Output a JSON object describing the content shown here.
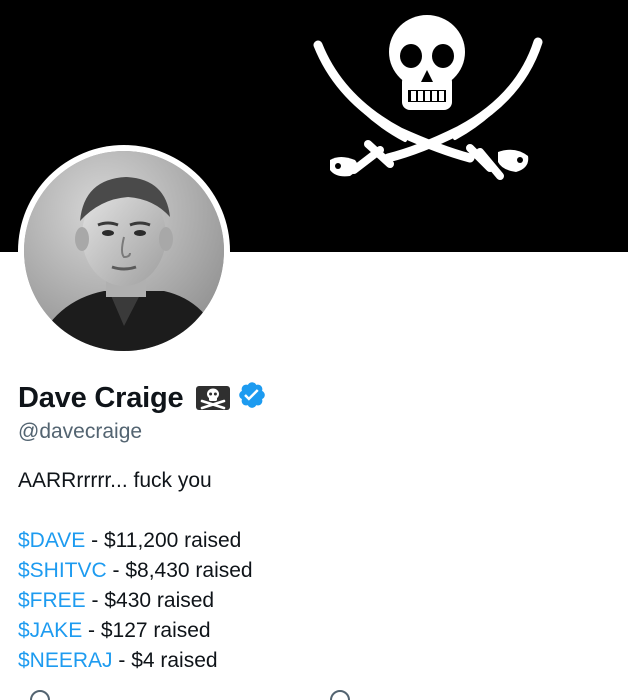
{
  "profile": {
    "display_name": "Dave Craige",
    "handle": "@davecraige",
    "bio_first_line": "AARRrrrrr... fuck you",
    "raises": [
      {
        "cashtag": "$DAVE",
        "text": " - $11,200 raised"
      },
      {
        "cashtag": "$SHITVC",
        "text": " - $8,430 raised"
      },
      {
        "cashtag": "$FREE",
        "text": " - $430 raised"
      },
      {
        "cashtag": "$JAKE",
        "text": " - $127 raised"
      },
      {
        "cashtag": "$NEERAJ",
        "text": " - $4 raised"
      }
    ]
  },
  "icons": {
    "banner": "jolly-roger-skull-crossed-swords",
    "name_emoji": "pirate-flag-icon",
    "badge": "verified-badge-icon"
  },
  "colors": {
    "accent": "#1d9bf0",
    "text": "#0f1419",
    "secondary_text": "#536471",
    "banner_bg": "#000000"
  }
}
